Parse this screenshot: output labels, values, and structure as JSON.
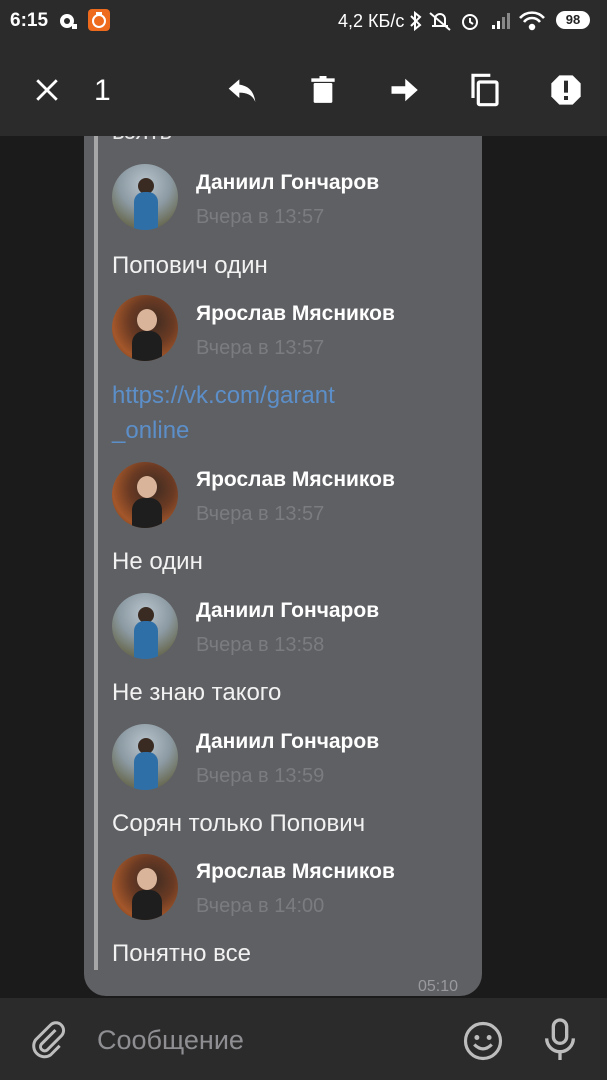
{
  "status_bar": {
    "time": "6:15",
    "network_speed": "4,2 КБ/с",
    "battery": "98"
  },
  "toolbar": {
    "selected_count": "1",
    "icons": [
      "close-icon",
      "reply-icon",
      "delete-icon",
      "forward-icon",
      "copy-icon",
      "report-icon"
    ]
  },
  "chat": {
    "cut_text": "взять",
    "messages": [
      {
        "author": "Даниил Гончаров",
        "time": "Вчера в 13:57",
        "text": "Попович один"
      },
      {
        "author": "Ярослав Мясников",
        "time": "Вчера в 13:57",
        "link": "https://vk.com/garant_online",
        "link_line1": "https://vk.com/garant",
        "link_line2": "_online"
      },
      {
        "author": "Ярослав Мясников",
        "time": "Вчера в 13:57",
        "text": "Не один"
      },
      {
        "author": "Даниил Гончаров",
        "time": "Вчера в 13:58",
        "text": "Не знаю такого"
      },
      {
        "author": "Даниил Гончаров",
        "time": "Вчера в 13:59",
        "text": "Сорян только Попович"
      },
      {
        "author": "Ярослав Мясников",
        "time": "Вчера в 14:00",
        "text": "Понятно все"
      }
    ],
    "bubble_time": "05:10"
  },
  "input": {
    "placeholder": "Сообщение"
  },
  "colors": {
    "background": "#1b1b1b",
    "bar": "#2b2b2b",
    "bubble": "#5f6063",
    "link": "#5c8fc9",
    "timestamp": "#7b7c80"
  }
}
